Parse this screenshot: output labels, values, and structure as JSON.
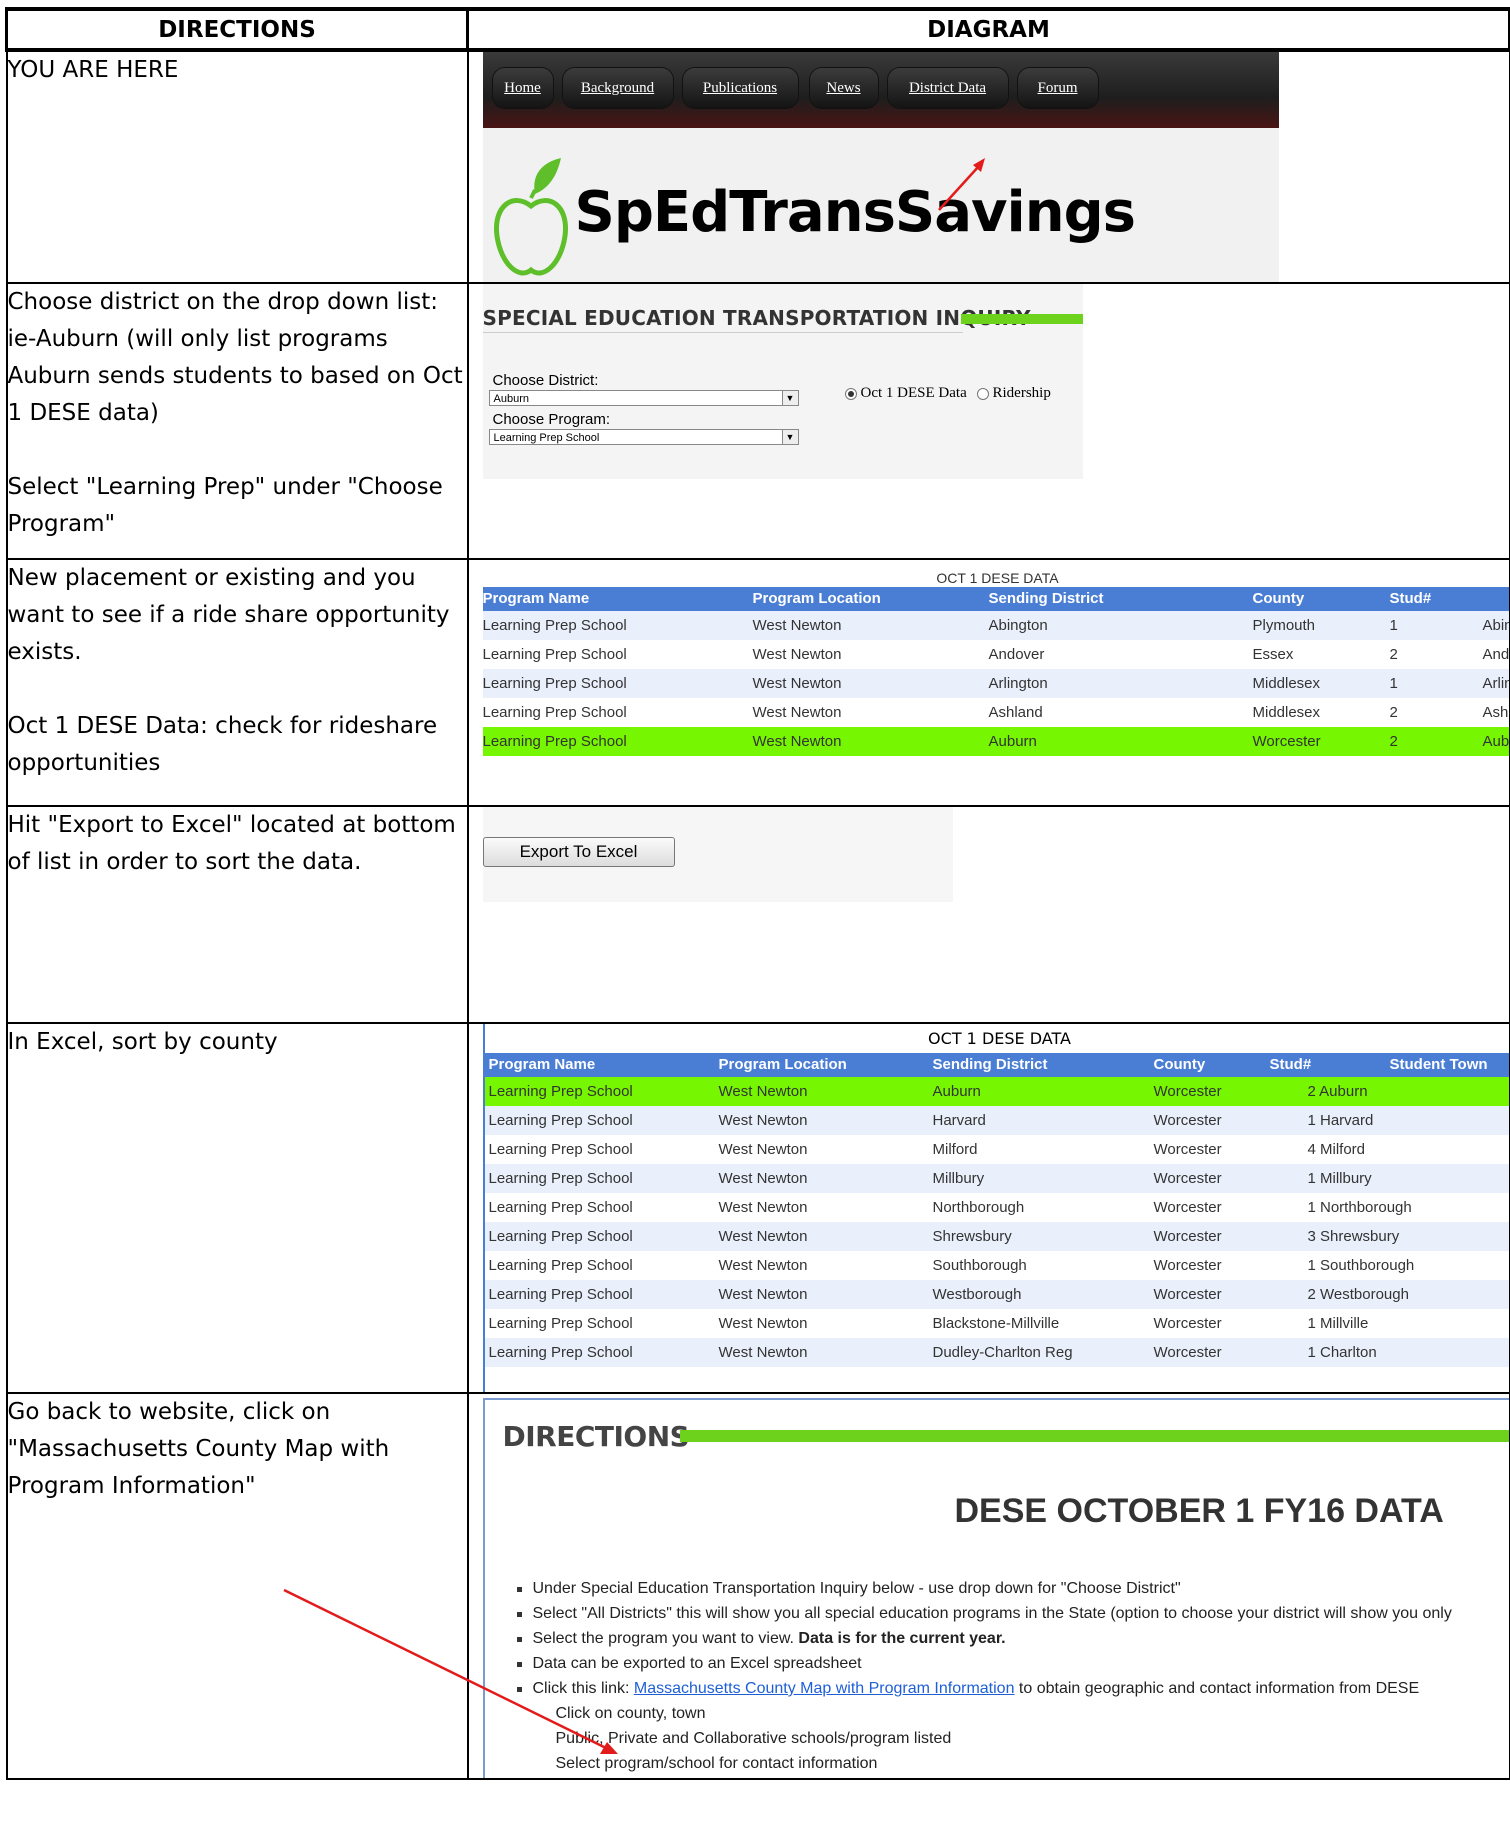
{
  "headers": {
    "directions": "DIRECTIONS",
    "diagram": "DIAGRAM"
  },
  "rows": {
    "r1": {
      "directions": [
        "YOU ARE HERE"
      ]
    },
    "r2": {
      "directions": [
        "Choose district on the drop down list: ie-Auburn (will only list programs Auburn sends students to based on Oct 1 DESE data)",
        "Select \"Learning Prep\" under \"Choose Program\""
      ]
    },
    "r3": {
      "directions": [
        "New placement or existing and you want to see if a ride share opportunity exists.",
        "Oct 1 DESE Data: check for rideshare opportunities"
      ]
    },
    "r4": {
      "directions": [
        "Hit \"Export to Excel\" located at bottom of list in order to sort the data."
      ]
    },
    "r5": {
      "directions": [
        "In Excel, sort by county"
      ]
    },
    "r6": {
      "directions": [
        "Go back to website, click on \"Massachusetts County Map with Program Information\""
      ]
    }
  },
  "nav": {
    "items": [
      "Home",
      "Background",
      "Publications",
      "News",
      "District Data",
      "Forum"
    ],
    "logo": "SpEdTransSavings"
  },
  "inquiry": {
    "title": "SPECIAL EDUCATION TRANSPORTATION INQUIRY",
    "district_label": "Choose District:",
    "district_value": "Auburn",
    "program_label": "Choose Program:",
    "program_value": "Learning Prep School",
    "radio_1": "Oct 1 DESE Data",
    "radio_2": "Ridership"
  },
  "table1": {
    "title": "OCT 1 DESE DATA",
    "columns": [
      "Program Name",
      "Program Location",
      "Sending District",
      "County",
      "Stud#"
    ],
    "rows": [
      [
        "Learning Prep School",
        "West Newton",
        "Abington",
        "Plymouth",
        "1",
        "Abin"
      ],
      [
        "Learning Prep School",
        "West Newton",
        "Andover",
        "Essex",
        "2",
        "Ando"
      ],
      [
        "Learning Prep School",
        "West Newton",
        "Arlington",
        "Middlesex",
        "1",
        "Arlin"
      ],
      [
        "Learning Prep School",
        "West Newton",
        "Ashland",
        "Middlesex",
        "2",
        "Ashl"
      ],
      [
        "Learning Prep School",
        "West Newton",
        "Auburn",
        "Worcester",
        "2",
        "Aubu"
      ]
    ]
  },
  "export": {
    "button": "Export To Excel"
  },
  "table2": {
    "title": "OCT 1 DESE DATA",
    "columns": [
      "Program Name",
      "Program Location",
      "Sending District",
      "County",
      "Stud#",
      "Student Town"
    ],
    "rows": [
      [
        "Learning Prep School",
        "West Newton",
        "Auburn",
        "Worcester",
        "2 Auburn"
      ],
      [
        "Learning Prep School",
        "West Newton",
        "Harvard",
        "Worcester",
        "1 Harvard"
      ],
      [
        "Learning Prep School",
        "West Newton",
        "Milford",
        "Worcester",
        "4 Milford"
      ],
      [
        "Learning Prep School",
        "West Newton",
        "Millbury",
        "Worcester",
        "1 Millbury"
      ],
      [
        "Learning Prep School",
        "West Newton",
        "Northborough",
        "Worcester",
        "1 Northborough"
      ],
      [
        "Learning Prep School",
        "West Newton",
        "Shrewsbury",
        "Worcester",
        "3 Shrewsbury"
      ],
      [
        "Learning Prep School",
        "West Newton",
        "Southborough",
        "Worcester",
        "1 Southborough"
      ],
      [
        "Learning Prep School",
        "West Newton",
        "Westborough",
        "Worcester",
        "2 Westborough"
      ],
      [
        "Learning Prep School",
        "West Newton",
        "Blackstone-Millville",
        "Worcester",
        "1 Millville"
      ],
      [
        "Learning Prep School",
        "West Newton",
        "Dudley-Charlton Reg",
        "Worcester",
        "1 Charlton"
      ]
    ]
  },
  "panel": {
    "title": "DIRECTIONS",
    "heading": "DESE OCTOBER 1 FY16 DATA",
    "b1": "Under Special Education Transportation Inquiry below - use drop down for \"Choose District\"",
    "b2": "Select \"All Districts\" this will show you all special education programs in the State (option to choose your district will show you only",
    "b3a": "Select the program you want to view. ",
    "b3b": "Data is for the current year.",
    "b4": "Data can be exported to an Excel spreadsheet",
    "b5a": "Click this link: ",
    "b5link": "Massachusetts County Map with Program Information",
    "b5b": " to obtain geographic and contact information from DESE",
    "s1": "Click on county, town",
    "s2": "Public, Private and Collaborative schools/program listed",
    "s3": "Select program/school for contact information"
  },
  "colors": {
    "header_blue": "#4a7dd4",
    "highlight_green": "#76f600",
    "accent_green": "#6cd21c",
    "arrow_red": "#e31b1b"
  }
}
